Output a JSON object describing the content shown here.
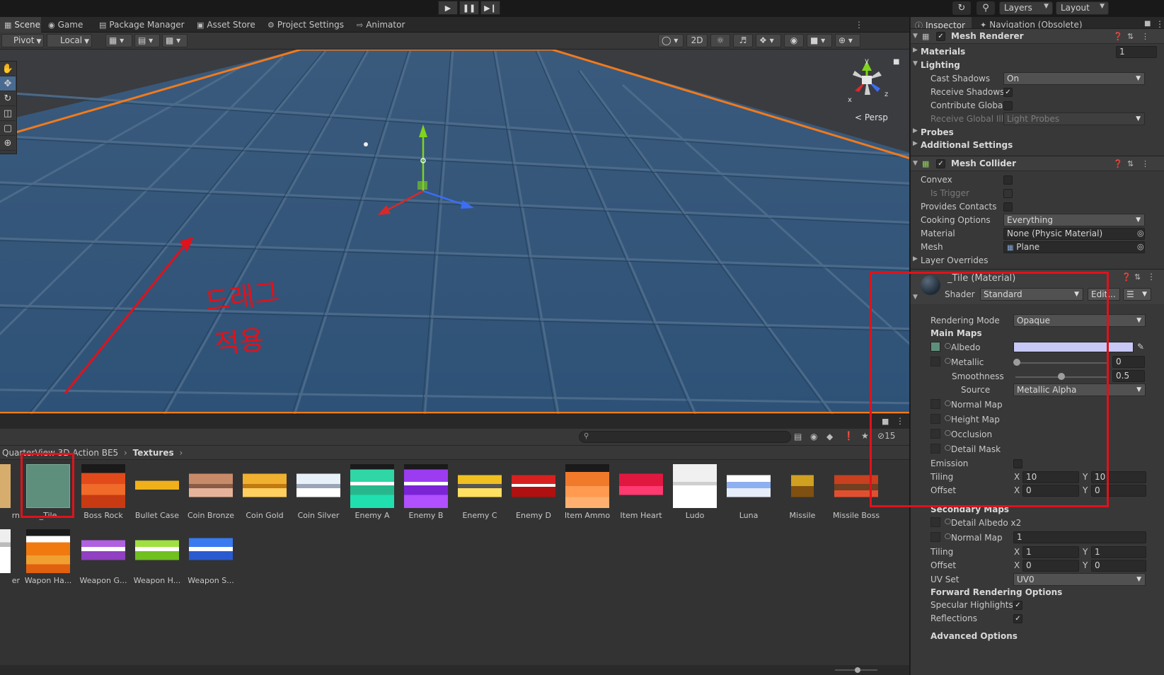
{
  "toolbar": {
    "layers_label": "Layers",
    "layout_label": "Layout"
  },
  "tabs": [
    {
      "label": "Scene",
      "icon": "grid-icon"
    },
    {
      "label": "Game",
      "icon": "gamepad-icon"
    },
    {
      "label": "Package Manager",
      "icon": "package-icon"
    },
    {
      "label": "Asset Store",
      "icon": "store-icon"
    },
    {
      "label": "Project Settings",
      "icon": "gear-icon"
    },
    {
      "label": "Animator",
      "icon": "animator-icon"
    }
  ],
  "scene_toolbar": {
    "pivot": "Pivot",
    "local": "Local",
    "mode_2d": "2D"
  },
  "scene": {
    "gizmo_persp": "Persp",
    "gizmo_x": "x",
    "gizmo_y": "y",
    "gizmo_z": "z",
    "annotation_line1": "드래그",
    "annotation_line2": "적용"
  },
  "project": {
    "hidden_count": "15",
    "search_placeholder": "",
    "breadcrumb": [
      "QuarterView 3D Action BE5",
      "Textures"
    ],
    "assets_row1": [
      "rn",
      "_Tile",
      "Boss Rock",
      "Bullet Case",
      "Coin Bronze",
      "Coin Gold",
      "Coin Silver",
      "Enemy A",
      "Enemy B",
      "Enemy C",
      "Enemy D",
      "Item Ammo",
      "Item Heart",
      "Ludo",
      "Luna",
      "Missile",
      "Missile Boss"
    ],
    "assets_row2": [
      "er",
      "Wapon Ha...",
      "Weapon G...",
      "Weapon H...",
      "Weapon S..."
    ]
  },
  "inspector": {
    "tabs": [
      "Inspector",
      "Navigation (Obsolete)"
    ],
    "mesh_renderer": {
      "title": "Mesh Renderer",
      "materials_label": "Materials",
      "materials_count": "1",
      "lighting_label": "Lighting",
      "cast_shadows_label": "Cast Shadows",
      "cast_shadows_value": "On",
      "receive_shadows_label": "Receive Shadows",
      "contribute_gi_label": "Contribute Global I",
      "receive_gi_label": "Receive Global Illu",
      "receive_gi_value": "Light Probes",
      "probes_label": "Probes",
      "additional_label": "Additional Settings"
    },
    "mesh_collider": {
      "title": "Mesh Collider",
      "convex_label": "Convex",
      "is_trigger_label": "Is Trigger",
      "provides_contacts_label": "Provides Contacts",
      "cooking_label": "Cooking Options",
      "cooking_value": "Everything",
      "material_label": "Material",
      "material_value": "None (Physic Material)",
      "mesh_label": "Mesh",
      "mesh_value": "Plane",
      "layer_overrides_label": "Layer Overrides"
    },
    "material": {
      "title": "_Tile (Material)",
      "shader_label": "Shader",
      "shader_value": "Standard",
      "edit_label": "Edit...",
      "rendering_mode_label": "Rendering Mode",
      "rendering_mode_value": "Opaque",
      "main_maps_label": "Main Maps",
      "albedo_label": "Albedo",
      "albedo_color": "#c8c8f6",
      "metallic_label": "Metallic",
      "metallic_value": "0",
      "smoothness_label": "Smoothness",
      "smoothness_value": "0.5",
      "source_label": "Source",
      "source_value": "Metallic Alpha",
      "normal_map_label": "Normal Map",
      "height_map_label": "Height Map",
      "occlusion_label": "Occlusion",
      "detail_mask_label": "Detail Mask",
      "emission_label": "Emission",
      "tiling_label": "Tiling",
      "tiling_x": "10",
      "tiling_y": "10",
      "offset_label": "Offset",
      "offset_x": "0",
      "offset_y": "0",
      "x_label": "X",
      "y_label": "Y",
      "secondary_maps_label": "Secondary Maps",
      "detail_albedo_label": "Detail Albedo x2",
      "sec_normal_map_label": "Normal Map",
      "sec_normal_value": "1",
      "sec_tiling_label": "Tiling",
      "sec_tiling_x": "1",
      "sec_tiling_y": "1",
      "sec_offset_label": "Offset",
      "sec_offset_x": "0",
      "sec_offset_y": "0",
      "uv_set_label": "UV Set",
      "uv_set_value": "UV0",
      "forward_label": "Forward Rendering Options",
      "specular_label": "Specular Highlights",
      "reflections_label": "Reflections",
      "advanced_label": "Advanced Options"
    }
  },
  "colors": {
    "highlight_red": "#e0121b",
    "selection_orange": "#f07a1c",
    "tile_teal": "#5e8f7d"
  }
}
